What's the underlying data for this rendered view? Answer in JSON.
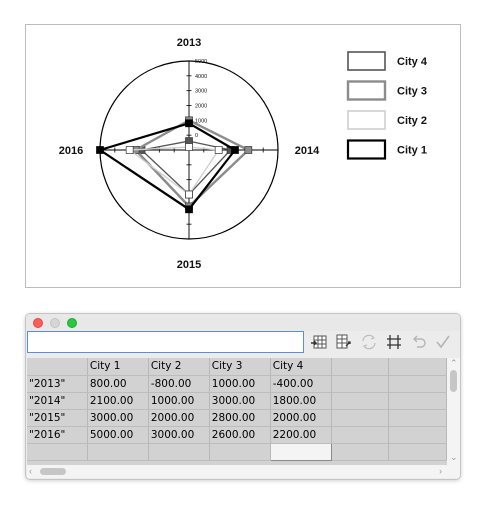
{
  "chart_data": {
    "type": "radar",
    "categories": [
      "2013",
      "2014",
      "2015",
      "2016"
    ],
    "radial_ticks": [
      "0",
      "1000",
      "2000",
      "3000",
      "4000",
      "5000"
    ],
    "rlim": [
      -1000,
      5000
    ],
    "series": [
      {
        "name": "City 4",
        "values": [
          -400,
          1800,
          2000,
          2200
        ],
        "color": "#555555",
        "width": 1.3
      },
      {
        "name": "City 3",
        "values": [
          1000,
          3000,
          2800,
          2600
        ],
        "color": "#8c8c8c",
        "width": 2.4
      },
      {
        "name": "City 2",
        "values": [
          -800,
          1000,
          2000,
          3000
        ],
        "color": "#cfcfcf",
        "width": 1.4
      },
      {
        "name": "City 1",
        "values": [
          800,
          2100,
          3000,
          5000
        ],
        "color": "#000000",
        "width": 2.2
      }
    ],
    "legend": {
      "placement": "right",
      "order": [
        "City 4",
        "City 3",
        "City 2",
        "City 1"
      ]
    }
  },
  "editor": {
    "input_value": "",
    "column_headers": [
      "",
      "City 1",
      "City 2",
      "City 3",
      "City 4",
      "",
      ""
    ],
    "rows": [
      [
        "\"2013\"",
        "800.00",
        "-800.00",
        "1000.00",
        "-400.00",
        "",
        ""
      ],
      [
        "\"2014\"",
        "2100.00",
        "1000.00",
        "3000.00",
        "1800.00",
        "",
        ""
      ],
      [
        "\"2015\"",
        "3000.00",
        "2000.00",
        "2800.00",
        "2000.00",
        "",
        ""
      ],
      [
        "\"2016\"",
        "5000.00",
        "3000.00",
        "2600.00",
        "2200.00",
        "",
        ""
      ],
      [
        "",
        "",
        "",
        "",
        "",
        "",
        ""
      ]
    ],
    "tools": [
      "import-data-icon",
      "transpose-icon",
      "switch-rows-columns-icon",
      "cell-style-icon",
      "undo-icon",
      "apply-icon"
    ]
  }
}
